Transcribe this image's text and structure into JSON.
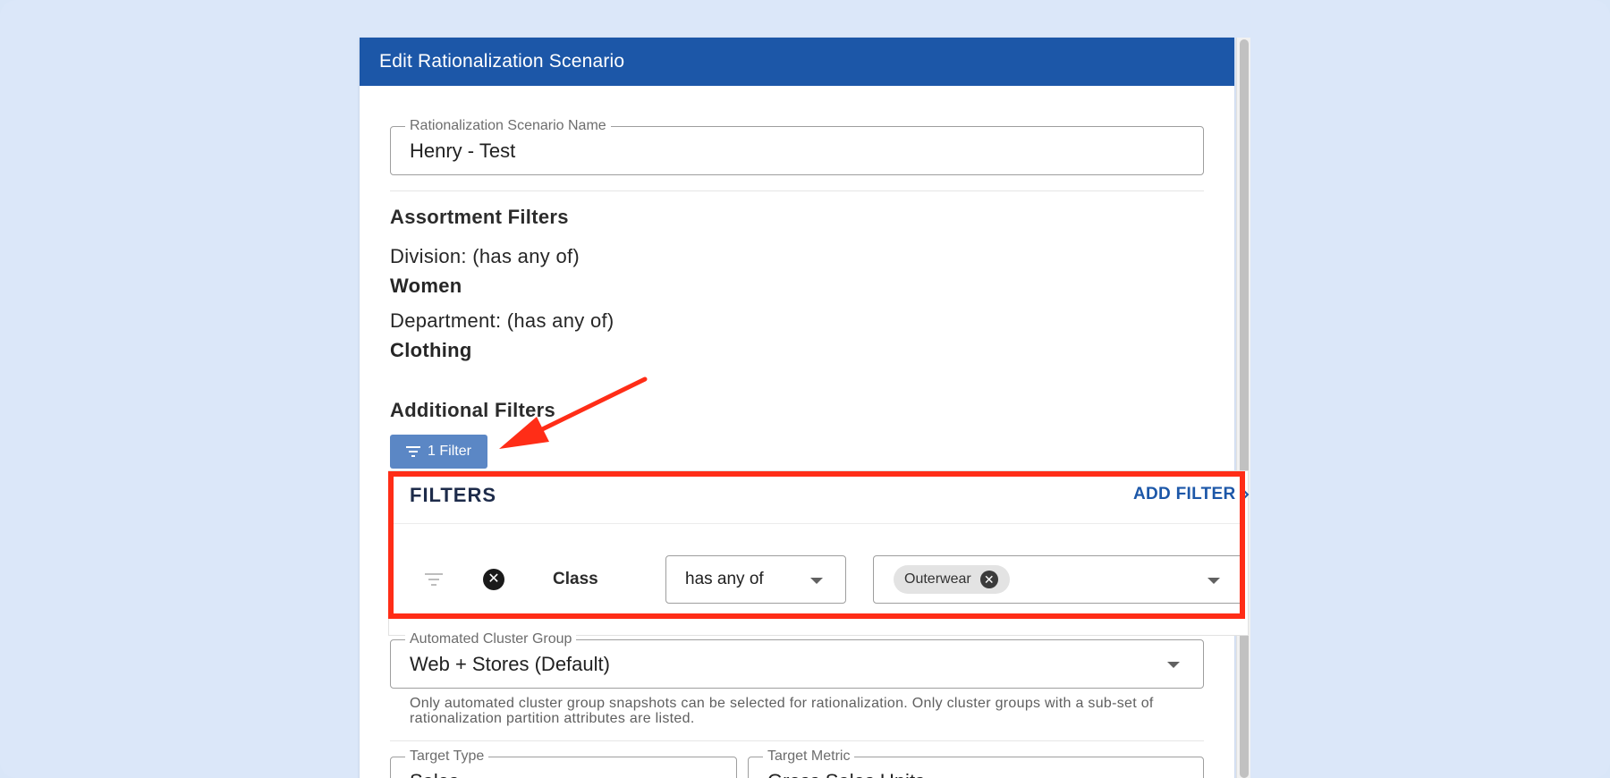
{
  "dialog": {
    "title": "Edit Rationalization Scenario"
  },
  "name_field": {
    "label": "Rationalization Scenario Name",
    "value": "Henry - Test"
  },
  "assortment": {
    "title": "Assortment Filters",
    "filters": [
      {
        "label": "Division: (has any of)",
        "value": "Women"
      },
      {
        "label": "Department: (has any of)",
        "value": "Clothing"
      }
    ]
  },
  "additional": {
    "title": "Additional Filters",
    "button_label": "1 Filter"
  },
  "filters_panel": {
    "title": "FILTERS",
    "add_label": "ADD FILTER",
    "row": {
      "attribute": "Class",
      "operator": "has any of",
      "chip": "Outerwear"
    }
  },
  "cluster_group": {
    "label": "Automated Cluster Group",
    "value": "Web + Stores (Default)",
    "helper": "Only automated cluster group snapshots can be selected for rationalization. Only cluster groups with a sub-set of rationalization partition attributes are listed."
  },
  "target_type": {
    "label": "Target Type",
    "value": "Sales"
  },
  "target_metric": {
    "label": "Target Metric",
    "value": "Gross Sales Units"
  },
  "colors": {
    "header": "#1c57a8",
    "highlight": "#ff2d17",
    "filter_button": "#5b87c5",
    "background": "#d9e6f8"
  }
}
